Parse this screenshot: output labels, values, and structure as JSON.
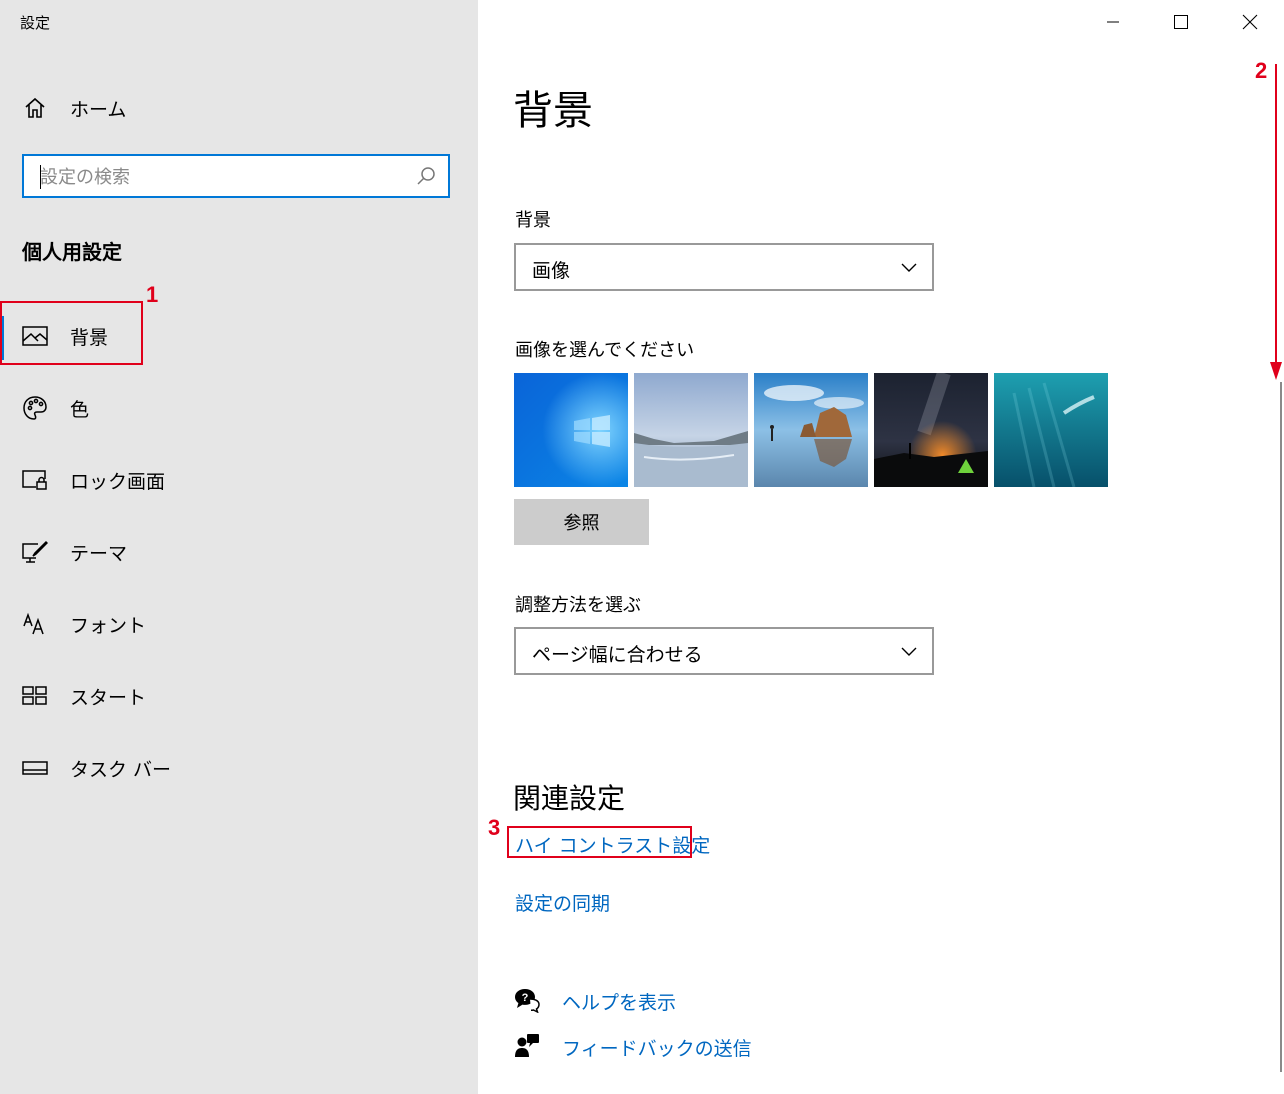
{
  "window": {
    "title": "設定",
    "controls": [
      "minimize-icon",
      "maximize-icon",
      "close-icon"
    ]
  },
  "sidebar": {
    "home_label": "ホーム",
    "search": {
      "placeholder": "設定の検索",
      "value": ""
    },
    "section_heading": "個人用設定",
    "items": [
      {
        "label": "背景",
        "icon": "picture-icon",
        "selected": true
      },
      {
        "label": "色",
        "icon": "palette-icon"
      },
      {
        "label": "ロック画面",
        "icon": "lock-screen-icon"
      },
      {
        "label": "テーマ",
        "icon": "theme-brush-icon"
      },
      {
        "label": "フォント",
        "icon": "font-icon"
      },
      {
        "label": "スタート",
        "icon": "start-tiles-icon"
      },
      {
        "label": "タスク バー",
        "icon": "taskbar-icon"
      }
    ]
  },
  "main": {
    "title": "背景",
    "background_label": "背景",
    "background_value": "画像",
    "choose_image_label": "画像を選んでください",
    "browse_label": "参照",
    "fit_label": "調整方法を選ぶ",
    "fit_value": "ページ幅に合わせる",
    "related_heading": "関連設定",
    "links": {
      "high_contrast": "ハイ コントラスト設定",
      "sync": "設定の同期",
      "help": "ヘルプを表示",
      "feedback": "フィードバックの送信"
    }
  },
  "annotations": {
    "n1": "1",
    "n2": "2",
    "n3": "3"
  },
  "colors": {
    "accent": "#0078d7",
    "link": "#0067c0",
    "annotation_red": "#e0001b",
    "sidebar_bg": "#e6e6e6"
  }
}
